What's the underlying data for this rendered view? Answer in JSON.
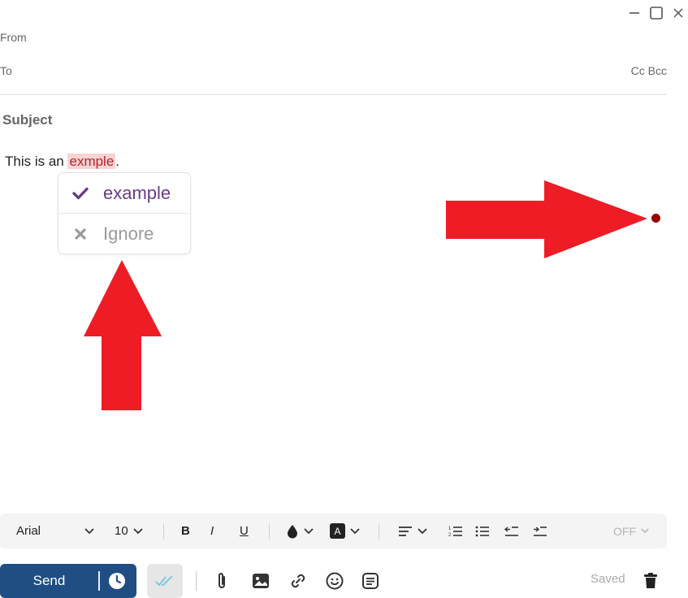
{
  "window": {
    "minimize_icon": "minimize-icon",
    "maximize_icon": "maximize-icon",
    "close_icon": "close-icon"
  },
  "header": {
    "from_label": "From",
    "to_label": "To",
    "cc_label": "Cc",
    "bcc_label": "Bcc",
    "subject_label": "Subject"
  },
  "body": {
    "text_before": "This is an ",
    "misspelled": "exmple",
    "text_after": "."
  },
  "suggestion": {
    "accept_label": "example",
    "ignore_label": "Ignore",
    "accept_color": "#6a3c88"
  },
  "annotations": {
    "arrow_color": "#ee1c25",
    "dot_color": "#9a0000"
  },
  "toolbar": {
    "font": "Arial",
    "size": "10",
    "bold": "B",
    "italic": "I",
    "underline": "U",
    "highlight_letter": "A",
    "toggle": "OFF"
  },
  "actions": {
    "send_label": "Send",
    "saved_label": "Saved",
    "send_color": "#1f4e85"
  }
}
